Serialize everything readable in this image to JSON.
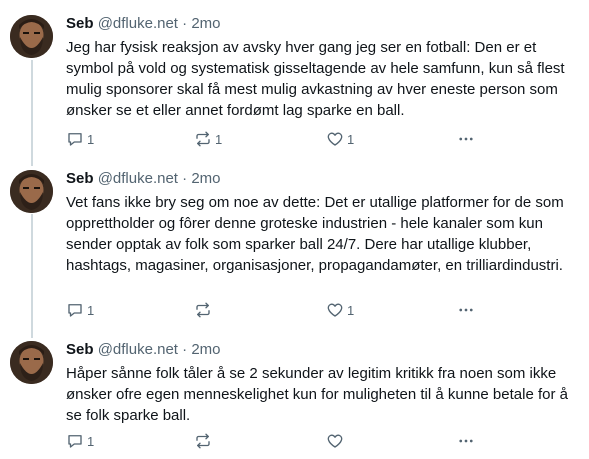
{
  "posts": [
    {
      "author": "Seb",
      "handle": "@dfluke.net",
      "separator": "·",
      "time": "2mo",
      "text": "Jeg har fysisk reaksjon av avsky hver gang jeg ser en fotball: Den er et symbol på vold og systematisk gisseltagende av hele samfunn, kun så flest mulig sponsorer skal få mest mulig avkastning av hver eneste person som ønsker se et eller annet fordømt lag sparke en ball.",
      "replies": "1",
      "reposts": "1",
      "likes": "1"
    },
    {
      "author": "Seb",
      "handle": "@dfluke.net",
      "separator": "·",
      "time": "2mo",
      "text": "Vet fans ikke bry seg om noe av dette: Det er utallige platformer for de som opprettholder og fôrer denne groteske industrien - hele kanaler som kun sender opptak av folk som sparker ball 24/7. Dere har utallige klubber, hashtags, magasiner, organisasjoner, propagandamøter, en trilliardindustri.",
      "replies": "1",
      "reposts": "",
      "likes": "1"
    },
    {
      "author": "Seb",
      "handle": "@dfluke.net",
      "separator": "·",
      "time": "2mo",
      "text": "Håper sånne folk tåler å se 2 sekunder av legitim kritikk fra noen som ikke ønsker ofre egen menneskelighet kun for muligheten til å kunne betale for å se folk sparke ball.",
      "replies": "1",
      "reposts": "",
      "likes": ""
    }
  ],
  "icons": {
    "reply": "reply-icon",
    "repost": "repost-icon",
    "like": "heart-icon",
    "more": "more-icon"
  },
  "colors": {
    "text": "#0f1419",
    "muted": "#536471",
    "thread_line": "#cfd9de"
  }
}
